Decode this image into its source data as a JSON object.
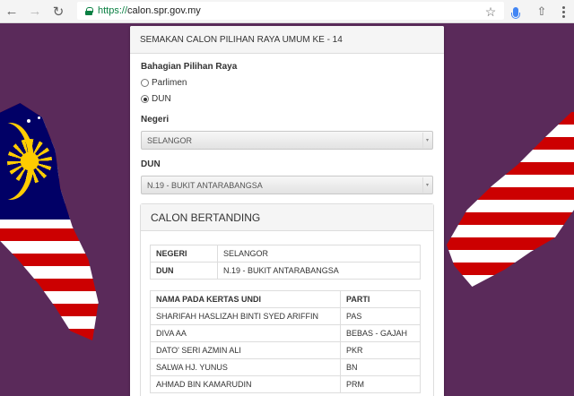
{
  "browser": {
    "url_scheme": "https://",
    "url_host": "calon.spr.gov.my",
    "icons": [
      "back-arrow-icon",
      "forward-arrow-icon",
      "reload-icon",
      "lock-icon",
      "star-icon",
      "mic-icon",
      "share-icon",
      "menu-icon"
    ]
  },
  "panel": {
    "title": "SEMAKAN CALON PILIHAN RAYA UMUM KE - 14",
    "section_label": "Bahagian Pilihan Raya",
    "radio_options": [
      {
        "label": "Parlimen",
        "checked": false
      },
      {
        "label": "DUN",
        "checked": true
      }
    ],
    "state_label": "Negeri",
    "state_value": "SELANGOR",
    "dun_label": "DUN",
    "dun_value": "N.19 - BUKIT ANTARABANGSA"
  },
  "candidates": {
    "title": "CALON BERTANDING",
    "info": [
      {
        "key": "NEGERI",
        "value": "SELANGOR"
      },
      {
        "key": "DUN",
        "value": "N.19 - BUKIT ANTARABANGSA"
      }
    ],
    "headers": {
      "name": "NAMA PADA KERTAS UNDI",
      "party": "PARTI"
    },
    "rows": [
      {
        "name": "SHARIFAH HASLIZAH BINTI SYED ARIFFIN",
        "party": "PAS"
      },
      {
        "name": "DIVA AA",
        "party": "BEBAS - GAJAH"
      },
      {
        "name": "DATO' SERI AZMIN ALI",
        "party": "PKR"
      },
      {
        "name": "SALWA HJ. YUNUS",
        "party": "BN"
      },
      {
        "name": "AHMAD BIN KAMARUDIN",
        "party": "PRM"
      }
    ]
  },
  "colors": {
    "background": "#5a2a5a",
    "flag_red": "#cc0001",
    "flag_blue": "#010066",
    "flag_yellow": "#ffcc00",
    "secure_green": "#0b8043"
  }
}
